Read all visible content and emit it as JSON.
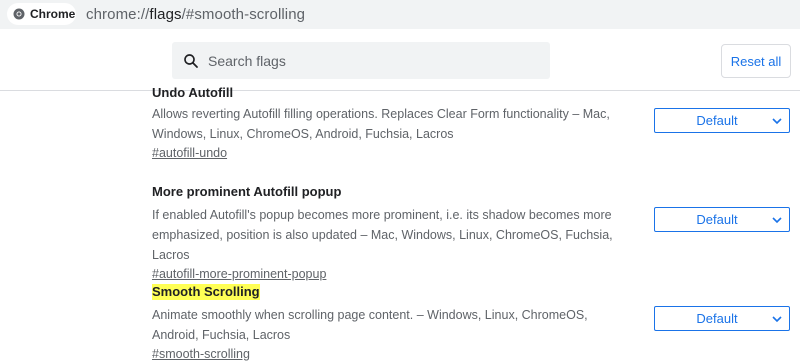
{
  "browser": {
    "chip_label": "Chrome",
    "url_prefix": "chrome://",
    "url_host": "flags",
    "url_path": "/#smooth-scrolling"
  },
  "header": {
    "search_placeholder": "Search flags",
    "reset_label": "Reset all"
  },
  "experiments": [
    {
      "title": "Undo Autofill",
      "description": "Allows reverting Autofill filling operations. Replaces Clear Form functionality – Mac, Windows, Linux, ChromeOS, Android, Fuchsia, Lacros",
      "link": "#autofill-undo",
      "value": "Default"
    },
    {
      "title": "More prominent Autofill popup",
      "description": "If enabled Autofill's popup becomes more prominent, i.e. its shadow becomes more emphasized, position is also updated – Mac, Windows, Linux, ChromeOS, Fuchsia, Lacros",
      "link": "#autofill-more-prominent-popup",
      "value": "Default"
    },
    {
      "title": "Smooth Scrolling",
      "description": "Animate smoothly when scrolling page content. – Windows, Linux, ChromeOS, Android, Fuchsia, Lacros",
      "link": "#smooth-scrolling",
      "value": "Default",
      "highlighted": true
    }
  ],
  "colors": {
    "accent": "#1a73e8",
    "highlight": "#ffff55",
    "toolbar_bg": "#f1f3f4"
  }
}
